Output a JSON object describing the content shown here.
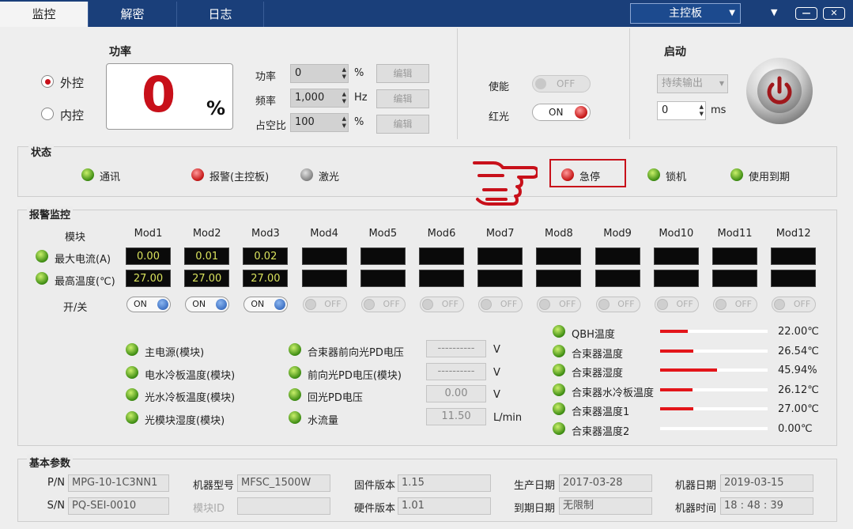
{
  "tabs": [
    "监控",
    "解密",
    "日志"
  ],
  "board_select": "主控板",
  "window_controls": {
    "menu": "▼",
    "minimize": "—",
    "close": "✕"
  },
  "power": {
    "title": "功率",
    "value": "0",
    "unit": "%",
    "mode_external": "外控",
    "mode_internal": "内控",
    "selected_mode": "外控"
  },
  "settings": {
    "power_label": "功率",
    "power_value": "0",
    "power_unit": "%",
    "freq_label": "频率",
    "freq_value": "1,000",
    "freq_unit": "Hz",
    "duty_label": "占空比",
    "duty_value": "100",
    "duty_unit": "%",
    "edit_label": "编辑"
  },
  "toggles": {
    "enable_label": "使能",
    "enable_state": "OFF",
    "red_light_label": "红光",
    "red_light_state": "ON"
  },
  "start": {
    "title": "启动",
    "mode": "持续输出",
    "duration_value": "0",
    "duration_unit": "ms"
  },
  "status": {
    "title": "状态",
    "items": [
      {
        "label": "通讯",
        "color": "green"
      },
      {
        "label": "报警(主控板)",
        "color": "red"
      },
      {
        "label": "激光",
        "color": "gray"
      },
      {
        "label": "急停",
        "color": "red"
      },
      {
        "label": "锁机",
        "color": "green"
      },
      {
        "label": "使用到期",
        "color": "green"
      }
    ]
  },
  "alarm": {
    "title": "报警监控",
    "module_header": "模块",
    "modules": [
      "Mod1",
      "Mod2",
      "Mod3",
      "Mod4",
      "Mod5",
      "Mod6",
      "Mod7",
      "Mod8",
      "Mod9",
      "Mod10",
      "Mod11",
      "Mod12"
    ],
    "max_current_label": "最大电流(A)",
    "max_temp_label": "最高温度(℃)",
    "switch_label": "开/关",
    "currents": [
      "0.00",
      "0.01",
      "0.02",
      "",
      "",
      "",
      "",
      "",
      "",
      "",
      "",
      ""
    ],
    "temps": [
      "27.00",
      "27.00",
      "27.00",
      "",
      "",
      "",
      "",
      "",
      "",
      "",
      "",
      ""
    ],
    "switches": [
      "ON",
      "ON",
      "ON",
      "OFF",
      "OFF",
      "OFF",
      "OFF",
      "OFF",
      "OFF",
      "OFF",
      "OFF",
      "OFF"
    ],
    "checks_col1": [
      "主电源(模块)",
      "电水冷板温度(模块)",
      "光水冷板温度(模块)",
      "光模块湿度(模块)"
    ],
    "checks_col2": [
      {
        "label": "合束器前向光PD电压",
        "value": "----------",
        "unit": "V"
      },
      {
        "label": "前向光PD电压(模块)",
        "value": "----------",
        "unit": "V"
      },
      {
        "label": "回光PD电压",
        "value": "0.00",
        "unit": "V"
      },
      {
        "label": "水流量",
        "value": "11.50",
        "unit": "L/min"
      }
    ],
    "sensors": [
      {
        "label": "QBH温度",
        "value": "22.00℃",
        "fill": 0.26
      },
      {
        "label": "合束器温度",
        "value": "26.54℃",
        "fill": 0.31
      },
      {
        "label": "合束器湿度",
        "value": "45.94%",
        "fill": 0.53
      },
      {
        "label": "合束器水冷板温度",
        "value": "26.12℃",
        "fill": 0.3
      },
      {
        "label": "合束器温度1",
        "value": "27.00℃",
        "fill": 0.31
      },
      {
        "label": "合束器温度2",
        "value": "0.00℃",
        "fill": 0
      }
    ]
  },
  "basic": {
    "title": "基本参数",
    "pn_label": "P/N",
    "pn": "MPG-10-1C3NN1",
    "sn_label": "S/N",
    "sn": "PQ-SEI-0010",
    "model_label": "机器型号",
    "model": "MFSC_1500W",
    "module_id_label": "模块ID",
    "module_id": "",
    "firmware_label": "固件版本",
    "firmware": "1.15",
    "hardware_label": "硬件版本",
    "hardware": "1.01",
    "prod_date_label": "生产日期",
    "prod_date": "2017-03-28",
    "expire_label": "到期日期",
    "expire": "无限制",
    "machine_date_label": "机器日期",
    "machine_date": "2019-03-15",
    "machine_time_label": "机器时间",
    "machine_time": "18 : 48 : 39"
  },
  "colors": {
    "titlebar": "#1a3f7a",
    "accent_red": "#c8101a",
    "display_text": "#d8e15c"
  }
}
